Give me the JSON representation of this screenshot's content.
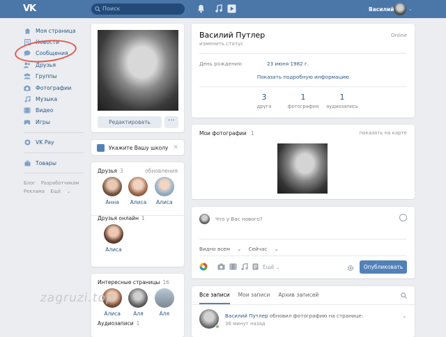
{
  "header": {
    "search_placeholder": "Поиск",
    "user_name": "Василий"
  },
  "nav": {
    "items": [
      {
        "label": "Моя страница",
        "icon": "home-icon"
      },
      {
        "label": "Новости",
        "icon": "news-icon"
      },
      {
        "label": "Сообщения",
        "icon": "messages-icon"
      },
      {
        "label": "Друзья",
        "icon": "friends-icon"
      },
      {
        "label": "Группы",
        "icon": "groups-icon"
      },
      {
        "label": "Фотографии",
        "icon": "camera-icon"
      },
      {
        "label": "Музыка",
        "icon": "music-icon"
      },
      {
        "label": "Видео",
        "icon": "video-icon"
      },
      {
        "label": "Игры",
        "icon": "games-icon"
      }
    ],
    "vkpay": "VK Pay",
    "goods": "Товары",
    "footer": {
      "blog": "Блог",
      "developers": "Разработчикам",
      "ads": "Реклама",
      "more": "Ещё"
    }
  },
  "left": {
    "edit_button": "Редактировать",
    "more_button": "···",
    "school_prompt": "Укажите Вашу школу",
    "friends": {
      "title": "Друзья",
      "count": "3",
      "updates": "обновления",
      "list": [
        "Анна",
        "Алиса",
        "Алиса"
      ]
    },
    "friends_online": {
      "title": "Друзья онлайн",
      "count": "1",
      "list": [
        "Алиса"
      ]
    },
    "interesting": {
      "title": "Интересные страницы",
      "count": "16",
      "list": [
        "Алиса",
        "Аля",
        "Аля"
      ]
    },
    "audio": {
      "title": "Аудиозаписи",
      "count": "1"
    }
  },
  "profile": {
    "name": "Василий Путлер",
    "status": "изменить статус",
    "online": "Online",
    "birthday_label": "День рождения:",
    "birthday_value": "23 июня 1982 г.",
    "more_info": "Показать подробную информацию",
    "counters": [
      {
        "value": "3",
        "label": "друга"
      },
      {
        "value": "1",
        "label": "фотография"
      },
      {
        "value": "1",
        "label": "аудиозапись"
      }
    ]
  },
  "photos": {
    "title": "Мои фотографии",
    "count": "1",
    "map_link": "показать на карте"
  },
  "post": {
    "placeholder": "Что у Вас нового?",
    "visibility": "Видно всем",
    "time": "Сейчас",
    "more": "Ещё",
    "publish": "Опубликовать"
  },
  "feed": {
    "tabs": [
      "Все записи",
      "Мои записи",
      "Архив записей"
    ],
    "item": {
      "author": "Василий Путлер",
      "action": "обновил фотографию на странице:",
      "time": "36 минут назад"
    }
  },
  "watermark": "zagruzi.top"
}
